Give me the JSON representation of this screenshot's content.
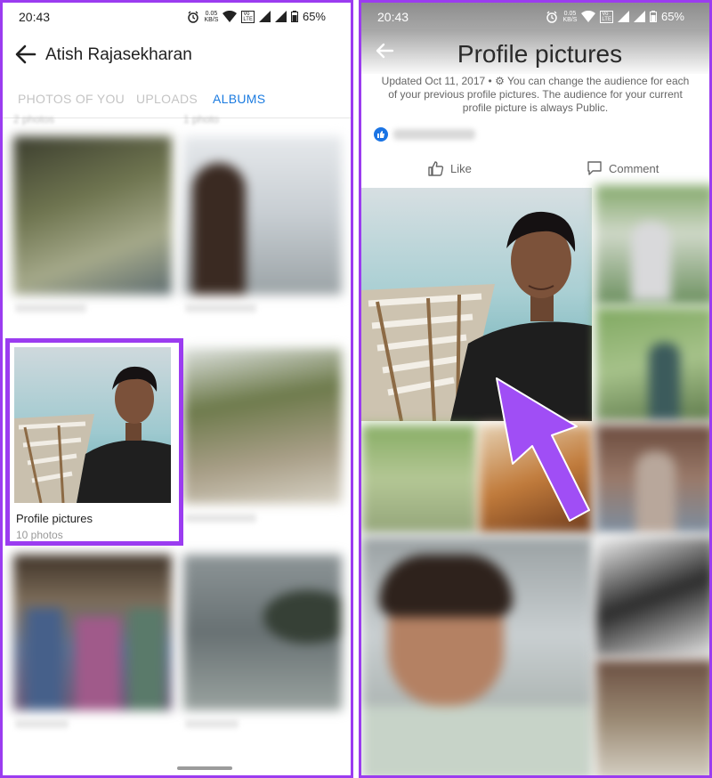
{
  "left": {
    "status": {
      "time": "20:43",
      "net_speed_top": "0.05",
      "net_speed_bottom": "KB/S",
      "volte_top": "Vo",
      "volte_bottom": "LTE",
      "battery": "65%"
    },
    "header": {
      "title": "Atish Rajasekharan"
    },
    "tabs": [
      {
        "label": "PHOTOS OF YOU",
        "active": false
      },
      {
        "label": "UPLOADS",
        "active": false
      },
      {
        "label": "ALBUMS",
        "active": true
      }
    ],
    "partial_counts": [
      "2 photos",
      "1 photo"
    ],
    "highlighted_album": {
      "name": "Profile pictures",
      "count": "10 photos"
    }
  },
  "right": {
    "status": {
      "time": "20:43",
      "net_speed_top": "0.05",
      "net_speed_bottom": "KB/S",
      "volte_top": "Vo",
      "volte_bottom": "LTE",
      "battery": "65%"
    },
    "title": "Profile pictures",
    "description": "Updated Oct 11, 2017 • ⚙ You can change the audience for each of your previous profile pictures. The audience for your current profile picture is always Public.",
    "like_label": "Like",
    "comment_label": "Comment"
  },
  "colors": {
    "highlight": "#9b3cf0",
    "tab_active": "#1b7be0",
    "like_badge": "#1b74e4"
  },
  "icons": [
    "back-arrow-icon",
    "alarm-icon",
    "wifi-icon",
    "signal-icon",
    "battery-icon",
    "thumbs-up-icon",
    "comment-icon",
    "like-badge-icon",
    "pointer-arrow-icon"
  ]
}
